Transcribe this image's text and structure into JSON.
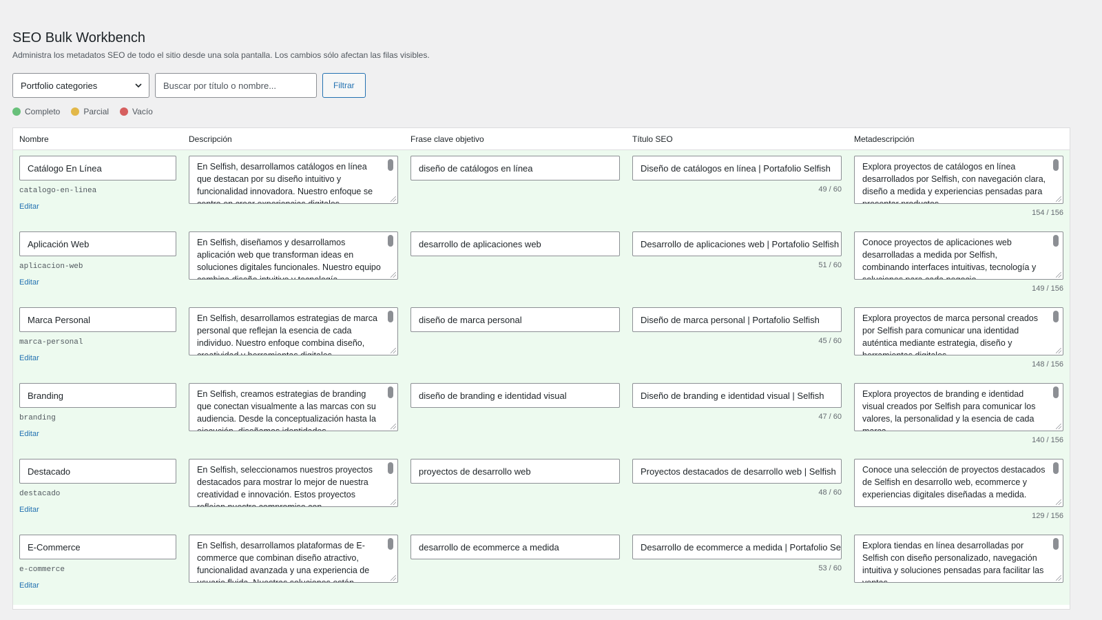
{
  "page": {
    "title": "SEO Bulk Workbench",
    "subtitle": "Administra los metadatos SEO de todo el sitio desde una sola pantalla. Los cambios sólo afectan las filas visibles."
  },
  "toolbar": {
    "select_value": "Portfolio categories",
    "search_placeholder": "Buscar por título o nombre...",
    "filter_label": "Filtrar"
  },
  "legend": [
    {
      "label": "Completo",
      "color": "#68c07a"
    },
    {
      "label": "Parcial",
      "color": "#e2b849"
    },
    {
      "label": "Vacío",
      "color": "#d65f5f"
    }
  ],
  "table": {
    "headers": [
      "Nombre",
      "Descripción",
      "Frase clave objetivo",
      "Título SEO",
      "Metadescripción"
    ],
    "edit_label": "Editar",
    "rows": [
      {
        "name": "Catálogo En Línea",
        "slug": "catalogo-en-linea",
        "description": "En Selfish, desarrollamos catálogos en línea que destacan por su diseño intuitivo y funcionalidad innovadora. Nuestro enfoque se centra en crear experiencias digitales",
        "keyphrase": "diseño de catálogos en línea",
        "seo_title": "Diseño de catálogos en línea | Portafolio Selfish",
        "title_count": "49 / 60",
        "meta": "Explora proyectos de catálogos en línea desarrollados por Selfish, con navegación clara, diseño a medida y experiencias pensadas para presentar productos.",
        "meta_count": "154 / 156"
      },
      {
        "name": "Aplicación Web",
        "slug": "aplicacion-web",
        "description": "En Selfish, diseñamos y desarrollamos aplicación web que transforman ideas en soluciones digitales funcionales. Nuestro equipo combina diseño intuitivo y tecnología",
        "keyphrase": "desarrollo de aplicaciones web",
        "seo_title": "Desarrollo de aplicaciones web | Portafolio Selfish",
        "title_count": "51 / 60",
        "meta": "Conoce proyectos de aplicaciones web desarrolladas a medida por Selfish, combinando interfaces intuitivas, tecnología y soluciones para cada negocio.",
        "meta_count": "149 / 156"
      },
      {
        "name": "Marca Personal",
        "slug": "marca-personal",
        "description": "En Selfish, desarrollamos estrategias de marca personal que reflejan la esencia de cada individuo. Nuestro enfoque combina diseño, creatividad y herramientas digitales",
        "keyphrase": "diseño de marca personal",
        "seo_title": "Diseño de marca personal | Portafolio Selfish",
        "title_count": "45 / 60",
        "meta": "Explora proyectos de marca personal creados por Selfish para comunicar una identidad auténtica mediante estrategia, diseño y herramientas digitales.",
        "meta_count": "148 / 156"
      },
      {
        "name": "Branding",
        "slug": "branding",
        "description": "En Selfish, creamos estrategias de branding que conectan visualmente a las marcas con su audiencia. Desde la conceptualización hasta la ejecución, diseñamos identidades",
        "keyphrase": "diseño de branding e identidad visual",
        "seo_title": "Diseño de branding e identidad visual | Selfish",
        "title_count": "47 / 60",
        "meta": "Explora proyectos de branding e identidad visual creados por Selfish para comunicar los valores, la personalidad y la esencia de cada marca.",
        "meta_count": "140 / 156"
      },
      {
        "name": "Destacado",
        "slug": "destacado",
        "description": "En Selfish, seleccionamos nuestros proyectos destacados para mostrar lo mejor de nuestra creatividad e innovación. Estos proyectos reflejan nuestro compromiso con",
        "keyphrase": "proyectos de desarrollo web",
        "seo_title": "Proyectos destacados de desarrollo web | Selfish",
        "title_count": "48 / 60",
        "meta": "Conoce una selección de proyectos destacados de Selfish en desarrollo web, ecommerce y experiencias digitales diseñadas a medida.",
        "meta_count": "129 / 156"
      },
      {
        "name": "E-Commerce",
        "slug": "e-commerce",
        "description": "En Selfish, desarrollamos plataformas de E-commerce que combinan diseño atractivo, funcionalidad avanzada y una experiencia de usuario fluida. Nuestras soluciones están",
        "keyphrase": "desarrollo de ecommerce a medida",
        "seo_title": "Desarrollo de ecommerce a medida | Portafolio Selfish",
        "title_count": "53 / 60",
        "meta": "Explora tiendas en línea desarrolladas por Selfish con diseño personalizado, navegación intuitiva y soluciones pensadas para facilitar las ventas.",
        "meta_count": ""
      }
    ]
  }
}
